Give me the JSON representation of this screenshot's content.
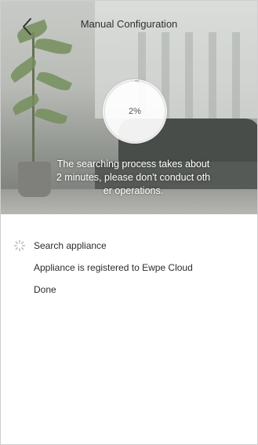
{
  "header": {
    "title": "Manual Configuration",
    "back_icon": "chevron-left-icon"
  },
  "progress": {
    "value_text": "2%",
    "percent": 2
  },
  "notice": {
    "lines": [
      "The searching process takes about",
      "2 minutes, please don't conduct oth",
      "er operations."
    ]
  },
  "steps": [
    {
      "label": "Search appliance",
      "state": "in-progress",
      "icon": "loading-spinner-icon"
    },
    {
      "label": "Appliance is registered to Ewpe Cloud",
      "state": "pending"
    },
    {
      "label": "Done",
      "state": "pending"
    }
  ]
}
